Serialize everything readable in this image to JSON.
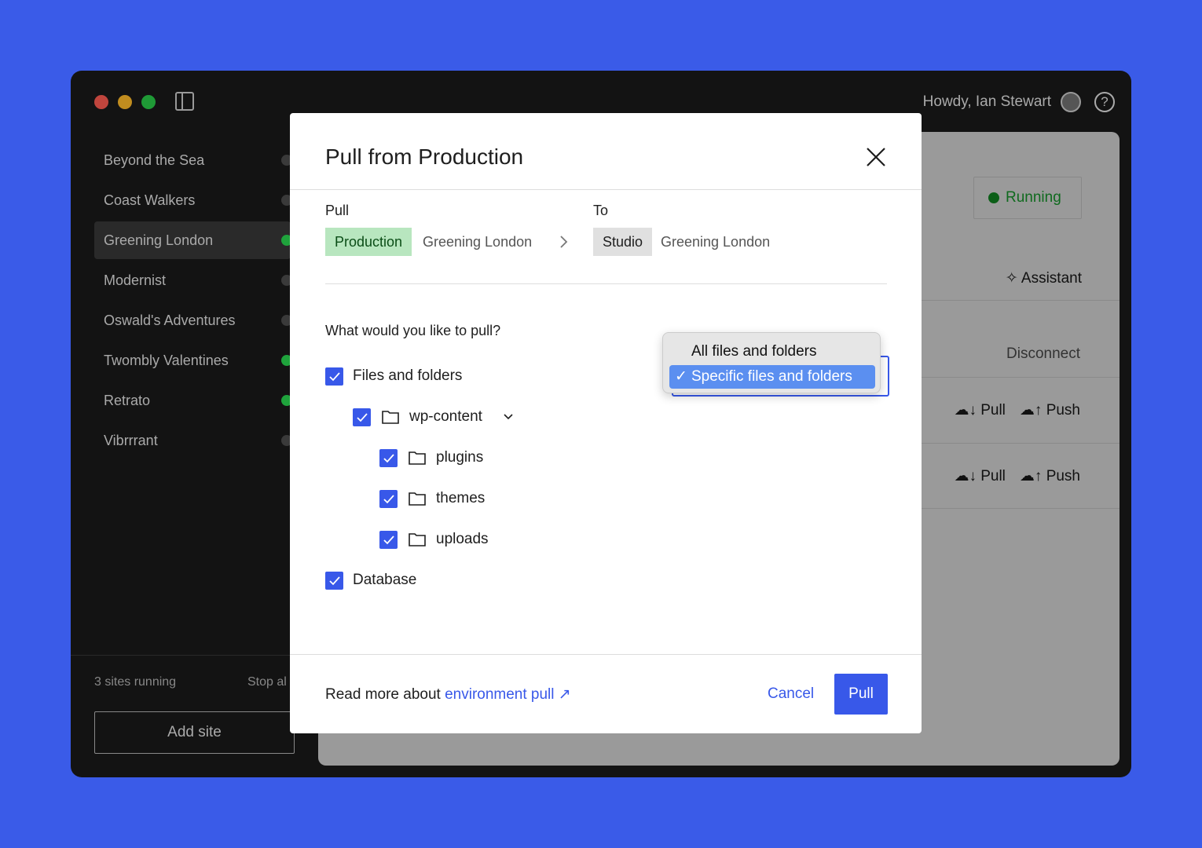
{
  "window": {
    "controls": {
      "close": "#c0453d",
      "minimize": "#c18d1f",
      "maximize": "#1f9a36"
    },
    "greeting": "Howdy, Ian Stewart",
    "help": "?"
  },
  "sidebar": {
    "sites": [
      {
        "name": "Beyond the Sea",
        "running": false
      },
      {
        "name": "Coast Walkers",
        "running": false
      },
      {
        "name": "Greening London",
        "running": true,
        "selected": true
      },
      {
        "name": "Modernist",
        "running": false
      },
      {
        "name": "Oswald's Adventures",
        "running": false
      },
      {
        "name": "Twombly Valentines",
        "running": true
      },
      {
        "name": "Retrato",
        "running": true
      },
      {
        "name": "Vibrrrant",
        "running": false
      }
    ],
    "running_count": "3 sites running",
    "stop_all": "Stop al",
    "add_site": "Add site"
  },
  "main": {
    "status": "Running",
    "assistant": "Assistant",
    "disconnect": "Disconnect",
    "pull": "Pull",
    "push": "Push"
  },
  "modal": {
    "title": "Pull from Production",
    "from_label": "Pull",
    "to_label": "To",
    "from_env": "Production",
    "from_site": "Greening London",
    "to_env": "Studio",
    "to_site": "Greening London",
    "question": "What would you like to pull?",
    "options": {
      "files": "Files and folders",
      "wp_content": "wp-content",
      "plugins": "plugins",
      "themes": "themes",
      "uploads": "uploads",
      "database": "Database"
    },
    "dropdown": {
      "items": [
        "All files and folders",
        "Specific files and folders"
      ],
      "selected": "Specific files and folders"
    },
    "read_more": "Read more about ",
    "link": "environment pull ↗",
    "cancel": "Cancel",
    "pull": "Pull"
  },
  "colors": {
    "accent": "#3858e9",
    "running": "#1fa33c",
    "production_chip": "#b8e6bf",
    "studio_chip": "#e0e0e0"
  }
}
